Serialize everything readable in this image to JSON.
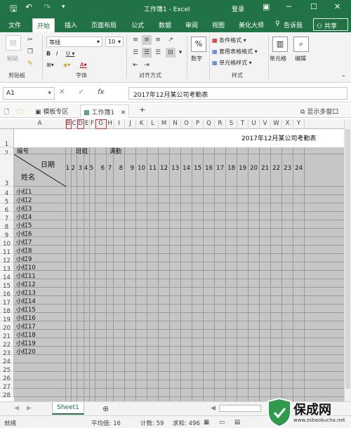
{
  "titlebar": {
    "title": "工作簿1 - Excel",
    "login": "登录"
  },
  "tabs": [
    "文件",
    "开始",
    "插入",
    "页面布局",
    "公式",
    "数据",
    "审阅",
    "视图",
    "美化大师"
  ],
  "tellme": "告诉我",
  "share": "共享",
  "ribbon": {
    "paste": "粘贴",
    "clipboard": "剪贴板",
    "font_name": "等线",
    "font_size": "10",
    "font_group": "字体",
    "align_group": "对齐方式",
    "number": "数字",
    "cond_format": "条件格式",
    "table_format": "套用表格格式",
    "cell_style": "单元格样式",
    "style_group": "样式",
    "cells": "单元格",
    "edit": "编辑"
  },
  "formula": {
    "namebox": "A1",
    "fx": "fx",
    "content": "2017年12月某公司考勤表"
  },
  "doctabs": {
    "template": "模板专区",
    "workbook": "工作簿1",
    "multi_window": "显示多窗口"
  },
  "columns": [
    "A",
    "B",
    "C",
    "D",
    "E",
    "F",
    "G",
    "H",
    "I",
    "J",
    "K",
    "L",
    "M",
    "N",
    "O",
    "P",
    "Q",
    "R",
    "S",
    "T",
    "U",
    "V",
    "W",
    "X",
    "Y"
  ],
  "sheet": {
    "title": "2017年12月某公司考勤表",
    "header": {
      "id": "编号",
      "team": "班组",
      "attendance": "满勤",
      "date": "日期",
      "name": "姓名"
    },
    "days": [
      "1",
      "2",
      "3",
      "4",
      "5",
      "6",
      "7",
      "8",
      "9",
      "10",
      "11",
      "12",
      "13",
      "14",
      "15",
      "16",
      "17",
      "18",
      "19",
      "20",
      "21",
      "22",
      "23",
      "24"
    ],
    "employees": [
      "小红1",
      "小红2",
      "小红3",
      "小红4",
      "小红5",
      "小红6",
      "小红7",
      "小红8",
      "小红9",
      "小红10",
      "小红11",
      "小红12",
      "小红13",
      "小红14",
      "小红15",
      "小红16",
      "小红17",
      "小红18",
      "小红19",
      "小红20"
    ],
    "rows": [
      "1",
      "2",
      "3",
      "4",
      "5",
      "6",
      "7",
      "8",
      "9",
      "10",
      "11",
      "12",
      "13",
      "14",
      "15",
      "16",
      "17",
      "18",
      "19",
      "20",
      "21",
      "22",
      "23",
      "24",
      "25",
      "26",
      "27",
      "28"
    ]
  },
  "sheettab": "Sheet1",
  "status": {
    "ready": "就绪",
    "average": "平均值: 16",
    "count": "计数: 59",
    "sum": "求和: 496"
  },
  "watermark": {
    "brand": "保成网",
    "url": "www.zsbaokucha.net"
  },
  "colors": {
    "excel_green": "#217346",
    "grid_fill": "#c6c6c6"
  }
}
